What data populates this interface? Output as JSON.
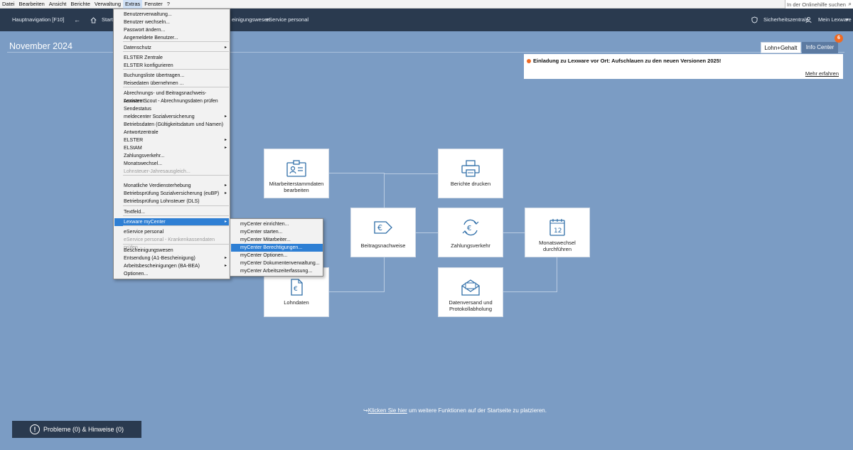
{
  "menubar": {
    "items": [
      "Datei",
      "Bearbeiten",
      "Ansicht",
      "Berichte",
      "Verwaltung",
      "Extras",
      "Fenster",
      "?"
    ],
    "active": "Extras",
    "search_placeholder": "In der Onlinehilfe suchen"
  },
  "navbar": {
    "main_nav": "Hauptnavigation [F10]",
    "back_arrow": "←",
    "home_text": "Start",
    "crumb_text": "einigungswesen",
    "eservice": "eService personal",
    "security": "Sicherheitszentrale",
    "account": "Mein Lexware"
  },
  "page": {
    "title": "November 2024"
  },
  "tabs": {
    "lohn": "Lohn+Gehalt",
    "info": "Info Center",
    "badge": "6"
  },
  "info": {
    "title": "Einladung zu Lexware vor Ort: Aufschlauen zu den neuen Versionen 2025!",
    "more": "Mehr erfahren"
  },
  "tiles": {
    "mitarbeiter": "Mitarbeiterstammdaten bearbeiten",
    "berichte": "Berichte drucken",
    "beitrag": "Beitragsnachweise",
    "zahlung": "Zahlungsverkehr",
    "monat": "Monatswechsel durchführen",
    "lohndaten": "Lohndaten",
    "datenversand": "Datenversand und Protokollabholung",
    "calendar_day": "12"
  },
  "extras_menu": {
    "items": [
      {
        "label": "Benutzerverwaltung..."
      },
      {
        "label": "Benutzer wechseln..."
      },
      {
        "label": "Passwort ändern..."
      },
      {
        "label": "Angemeldete Benutzer..."
      },
      {
        "label": "Datenschutz",
        "sub": true
      },
      {
        "label": "ELSTER Zentrale"
      },
      {
        "label": "ELSTER konfigurieren"
      },
      {
        "label": "Buchungsliste übertragen..."
      },
      {
        "label": "Reisedaten übernehmen ..."
      },
      {
        "label": "Abrechnungs- und Beitragsnachweis-Assistent..."
      },
      {
        "label": "Lexware Scout - Abrechnungsdaten prüfen"
      },
      {
        "label": "Sendestatus"
      },
      {
        "label": "meldecenter Sozialversicherung",
        "sub": true
      },
      {
        "label": "Betriebsdaten (Gültigkeitsdatum und Namen)"
      },
      {
        "label": "Antwortzentrale"
      },
      {
        "label": "ELSTER",
        "sub": true
      },
      {
        "label": "ELStAM",
        "sub": true
      },
      {
        "label": "Zahlungsverkehr..."
      },
      {
        "label": "Monatswechsel..."
      },
      {
        "label": "Lohnsteuer-Jahresausgleich...",
        "disabled": true
      },
      {
        "label": "Monatliche Verdiensterhebung",
        "sub": true
      },
      {
        "label": "Betriebsprüfung Sozialversicherung (euBP)",
        "sub": true
      },
      {
        "label": "Betriebsprüfung Lohnsteuer (DLS)"
      },
      {
        "label": "Textfeld..."
      },
      {
        "label": "Lexware myCenter",
        "sub": true,
        "active": true
      },
      {
        "label": "eService personal"
      },
      {
        "label": "eService personal - Krankenkassendaten prüfen",
        "disabled": true
      },
      {
        "label": "Bescheinigungswesen"
      },
      {
        "label": "Entsendung (A1-Bescheinigung)",
        "sub": true
      },
      {
        "label": "Arbeitsbescheinigungen (BA-BEA)",
        "sub": true
      },
      {
        "label": "Optionen..."
      }
    ]
  },
  "mycenter_menu": {
    "items": [
      "myCenter einrichten...",
      "myCenter starten...",
      "myCenter Mitarbeiter...",
      "myCenter Berechtigungen...",
      "myCenter Optionen...",
      "myCenter Dokumentenverwaltung...",
      "myCenter Arbeitszeiterfassung..."
    ],
    "active_index": 3
  },
  "footer": {
    "hint_link": "Klicken Sie hier",
    "hint_rest": " um weitere Funktionen auf der Startseite zu platzieren.",
    "problems": "Probleme (0) & Hinweise (0)"
  },
  "colors": {
    "background": "#7b9cc4",
    "navbar": "#2a3a4f",
    "accent": "#2e7fd4",
    "badge": "#ef6a23"
  }
}
